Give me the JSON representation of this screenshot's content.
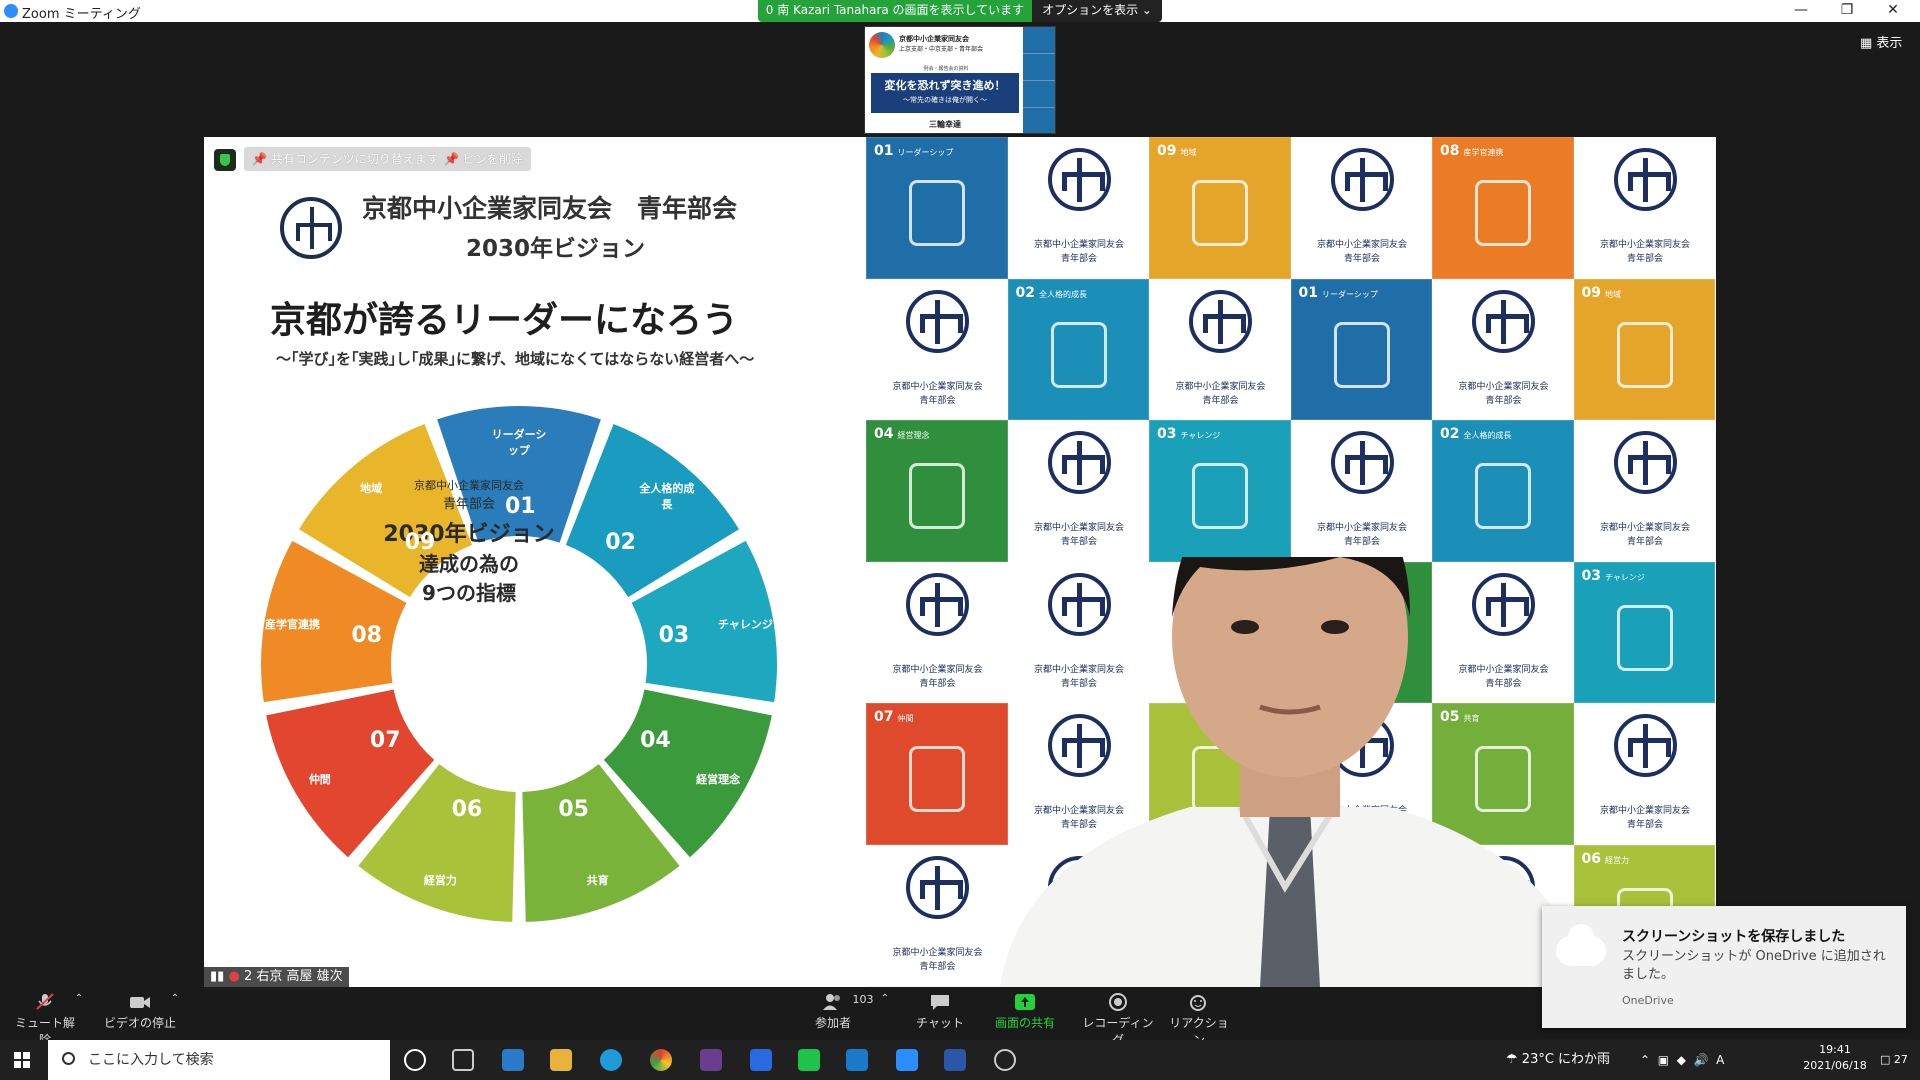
{
  "window": {
    "title": "Zoom ミーティング",
    "share_banner": "南 Kazari  Tanahara の画面を表示しています",
    "share_banner_badge": "0",
    "options_label": "オプションを表示 ⌄",
    "view_label": "▦ 表示"
  },
  "thumbnail": {
    "org": "京都中小企業家同友会",
    "line2": "上京支部・中京支部・青年部会",
    "small": "例会・報告会の資料",
    "title": "変化を恐れず突き進め！",
    "subtitle": "〜常先の確きは俺が開く〜",
    "speaker": "三輪幸達"
  },
  "share_controls": {
    "switch_label": "共有コンテンツに切り替えます",
    "unpin_label": "ピンを削除"
  },
  "slide": {
    "org": "京都中小企業家同友会　青年部会",
    "vision": "2030年ビジョン",
    "headline": "京都が誇るリーダーになろう",
    "subline": "〜｢学び｣を｢実践｣し｢成果｣に繋げ、地域になくてはならない経営者へ〜",
    "center": {
      "org": "京都中小企業家同友会",
      "dept": "青年部会",
      "vision": "2030年ビジョン",
      "line2": "達成の為の",
      "line3": "9つの指標"
    },
    "segments": [
      {
        "num": "01",
        "label": "リーダーシップ",
        "color": "#2a7cba"
      },
      {
        "num": "02",
        "label": "全人格的成長",
        "color": "#1a9bc0"
      },
      {
        "num": "03",
        "label": "チャレンジ",
        "color": "#1ea8c0"
      },
      {
        "num": "04",
        "label": "経営理念",
        "color": "#3b9a3c"
      },
      {
        "num": "05",
        "label": "共育",
        "color": "#79b33a"
      },
      {
        "num": "06",
        "label": "経営力",
        "color": "#a8c23a"
      },
      {
        "num": "07",
        "label": "仲間",
        "color": "#e2462e"
      },
      {
        "num": "08",
        "label": "産学官連携",
        "color": "#f08a24"
      },
      {
        "num": "09",
        "label": "地域",
        "color": "#e9b52a"
      }
    ]
  },
  "background_grid": {
    "logo_text_1": "京都中小企業家同友会",
    "logo_text_2": "青年部会",
    "cells": [
      {
        "type": "tile",
        "num": "01",
        "label": "リーダーシップ",
        "color": "#1f6ea8"
      },
      {
        "type": "logo"
      },
      {
        "type": "tile",
        "num": "09",
        "label": "地域",
        "color": "#e5a52a"
      },
      {
        "type": "logo"
      },
      {
        "type": "tile",
        "num": "08",
        "label": "産学官連携",
        "color": "#ec7b25"
      },
      {
        "type": "logo"
      },
      {
        "type": "logo"
      },
      {
        "type": "tile",
        "num": "02",
        "label": "全人格的成長",
        "color": "#1b8fb8"
      },
      {
        "type": "logo"
      },
      {
        "type": "tile",
        "num": "01",
        "label": "リーダーシップ",
        "color": "#1f6ea8"
      },
      {
        "type": "logo"
      },
      {
        "type": "tile",
        "num": "09",
        "label": "地域",
        "color": "#e5a52a"
      },
      {
        "type": "tile",
        "num": "04",
        "label": "経営理念",
        "color": "#2f8f3c"
      },
      {
        "type": "logo"
      },
      {
        "type": "tile",
        "num": "03",
        "label": "チャレンジ",
        "color": "#1aa0b8"
      },
      {
        "type": "logo"
      },
      {
        "type": "tile",
        "num": "02",
        "label": "全人格的成長",
        "color": "#1b8fb8"
      },
      {
        "type": "logo"
      },
      {
        "type": "logo"
      },
      {
        "type": "logo"
      },
      {
        "type": "logo"
      },
      {
        "type": "tile",
        "num": "04",
        "label": "経営理念",
        "color": "#2f8f3c"
      },
      {
        "type": "logo"
      },
      {
        "type": "tile",
        "num": "03",
        "label": "チャレンジ",
        "color": "#1aa0b8"
      },
      {
        "type": "tile",
        "num": "07",
        "label": "仲間",
        "color": "#e04a2c"
      },
      {
        "type": "logo"
      },
      {
        "type": "tile",
        "num": "",
        "label": "",
        "color": "#a9c13a"
      },
      {
        "type": "logo"
      },
      {
        "type": "tile",
        "num": "05",
        "label": "共育",
        "color": "#74ae3b"
      },
      {
        "type": "logo"
      },
      {
        "type": "logo"
      },
      {
        "type": "logo"
      },
      {
        "type": "tile",
        "num": "",
        "label": "",
        "color": "#e04a2c"
      },
      {
        "type": "logo"
      },
      {
        "type": "logo"
      },
      {
        "type": "tile",
        "num": "06",
        "label": "経営力",
        "color": "#a9c13a"
      }
    ]
  },
  "participant": {
    "name": "右京 高屋 雄次",
    "index": "2"
  },
  "toolbar": {
    "mute_label": "ミュート解除",
    "video_label": "ビデオの停止",
    "participants_label": "参加者",
    "participants_count": "103",
    "chat_label": "チャット",
    "share_label": "画面の共有",
    "record_label": "レコーディング",
    "reaction_label": "リアクション"
  },
  "toast": {
    "title": "スクリーンショットを保存しました",
    "body": "スクリーンショットが OneDrive に追加されました。",
    "source": "OneDrive"
  },
  "taskbar": {
    "search_placeholder": "ここに入力して検索",
    "weather": "23°C  にわか雨",
    "ime": "A",
    "time": "19:41",
    "date": "2021/06/18",
    "notifications": "27"
  },
  "colors": {
    "zoom_blue": "#2d8cff",
    "share_green": "#23a33a",
    "toolbar_bg": "#1a1a1a",
    "taskbar_bg": "#202020"
  }
}
